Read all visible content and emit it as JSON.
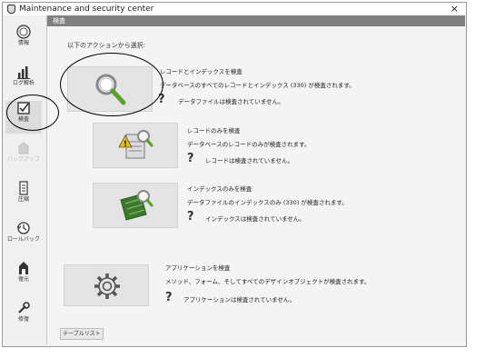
{
  "window": {
    "title": "Maintenance and security center",
    "close_label": "×"
  },
  "sidebar": {
    "items": [
      {
        "label": "情報",
        "icon": "info-icon"
      },
      {
        "label": "ログ解析",
        "icon": "log-analysis-icon"
      },
      {
        "label": "検査",
        "icon": "verify-icon"
      },
      {
        "label": "バックアップ",
        "icon": "backup-icon"
      },
      {
        "label": "圧縮",
        "icon": "compact-icon"
      },
      {
        "label": "ロールバック",
        "icon": "rollback-icon"
      },
      {
        "label": "復元",
        "icon": "restore-icon"
      },
      {
        "label": "修復",
        "icon": "repair-icon"
      }
    ],
    "active_label": "検査",
    "disabled_label": "バックアップ"
  },
  "main": {
    "header": "検査",
    "prompt": "以下のアクションから選択:",
    "actions": [
      {
        "title": "レコードとインデックスを検査",
        "description": "データベースのすべてのレコードとインデックス (330) が検査されます。",
        "status": "データファイルは検査されていません。",
        "icon": "magnifier-icon"
      },
      {
        "title": "レコードのみを検査",
        "description": "データベースのレコードのみが検査されます。",
        "status": "レコードは検査されていません。",
        "icon": "records-warning-icon"
      },
      {
        "title": "インデックスのみを検査",
        "description": "データファイルのインデックスのみ (330) が検査されます。",
        "status": "インデックスは検査されていません。",
        "icon": "index-icon"
      },
      {
        "title": "アプリケーションを検査",
        "description": "メソッド、フォーム、そしてすべてのデザインオブジェクトが検査されます。",
        "status": "アプリケーションは検査されていません。",
        "icon": "gear-icon"
      }
    ],
    "status_glyph": "?",
    "table_list_label": "テーブルリスト"
  },
  "colors": {
    "header_bg": "#808080",
    "magnifier_handle": "#5aa02c",
    "annotation": "#000000"
  }
}
